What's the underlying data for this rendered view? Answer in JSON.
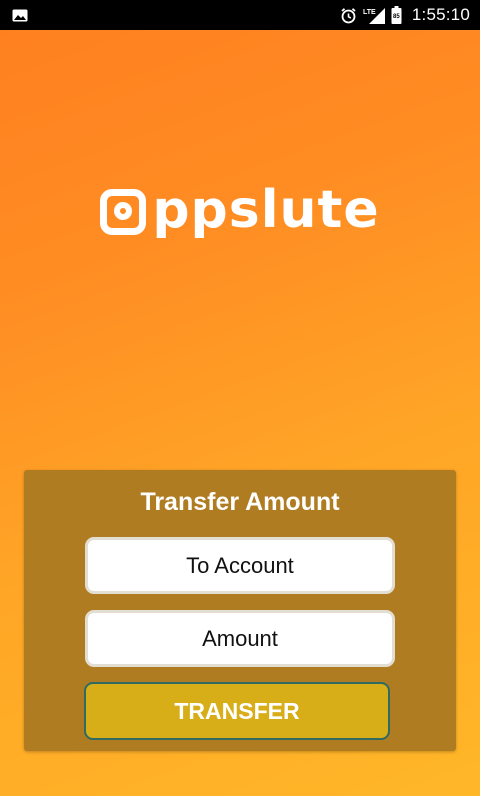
{
  "status_bar": {
    "time": "1:55:10",
    "network": "LTE",
    "icons": [
      "image-icon",
      "alarm-icon",
      "signal-icon",
      "battery-icon"
    ]
  },
  "logo": {
    "text": "ppslute",
    "brand_color": "#FFFFFF"
  },
  "transfer_card": {
    "title": "Transfer Amount",
    "to_account_placeholder": "To Account",
    "amount_placeholder": "Amount",
    "transfer_button_label": "TRANSFER",
    "card_color": "#B07C22",
    "button_color": "#D8AE18"
  },
  "colors": {
    "background_start": "#FF7F20",
    "background_end": "#FFB728"
  }
}
